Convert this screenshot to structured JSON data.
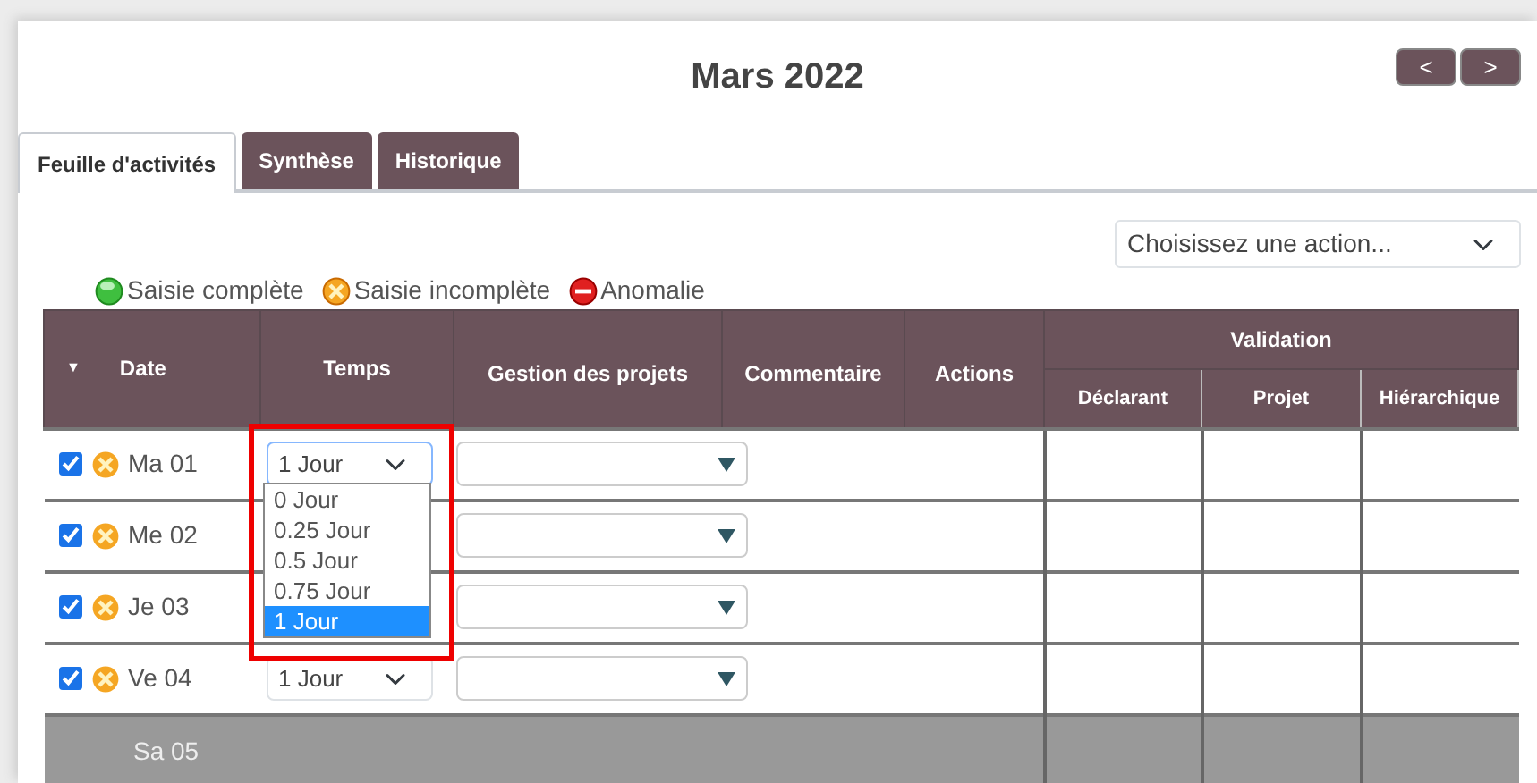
{
  "title": "Mars 2022",
  "nav_buttons": [
    "<",
    ">"
  ],
  "tabs": [
    {
      "label": "Feuille d'activités",
      "selected": true
    },
    {
      "label": "Synthèse",
      "selected": false
    },
    {
      "label": "Historique",
      "selected": false
    }
  ],
  "action_select": {
    "placeholder": "Choisissez une action..."
  },
  "legend": [
    {
      "kind": "complete",
      "label": "Saisie complète"
    },
    {
      "kind": "incomplete",
      "label": "Saisie incomplète"
    },
    {
      "kind": "anomaly",
      "label": "Anomalie"
    }
  ],
  "table": {
    "sort_icon": "▼",
    "columns": [
      "Date",
      "Temps",
      "Gestion des projets",
      "Commentaire",
      "Actions"
    ],
    "group": {
      "label": "Validation",
      "columns": [
        "Déclarant",
        "Projet",
        "Hiérarchique"
      ]
    },
    "rows": [
      {
        "kind": "workday",
        "checked": true,
        "color": "#f5a623",
        "date": "Ma 01",
        "temps": "1 Jour",
        "dropdown_open": true
      },
      {
        "kind": "workday",
        "checked": true,
        "color": "#f5a623",
        "date": "Me 02"
      },
      {
        "kind": "workday",
        "checked": true,
        "color": "#f5a623",
        "date": "Je 03"
      },
      {
        "kind": "workday",
        "checked": true,
        "color": "#f5a623",
        "date": "Ve 04",
        "temps": "1 Jour",
        "dropdown_open": false
      },
      {
        "kind": "weekend",
        "date": "Sa 05"
      }
    ]
  },
  "temps_options": [
    {
      "label": "0 Jour",
      "selected": false
    },
    {
      "label": "0.25 Jour",
      "selected": false
    },
    {
      "label": "0.5 Jour",
      "selected": false
    },
    {
      "label": "0.75 Jour",
      "selected": false
    },
    {
      "label": "1 Jour",
      "selected": true
    }
  ]
}
